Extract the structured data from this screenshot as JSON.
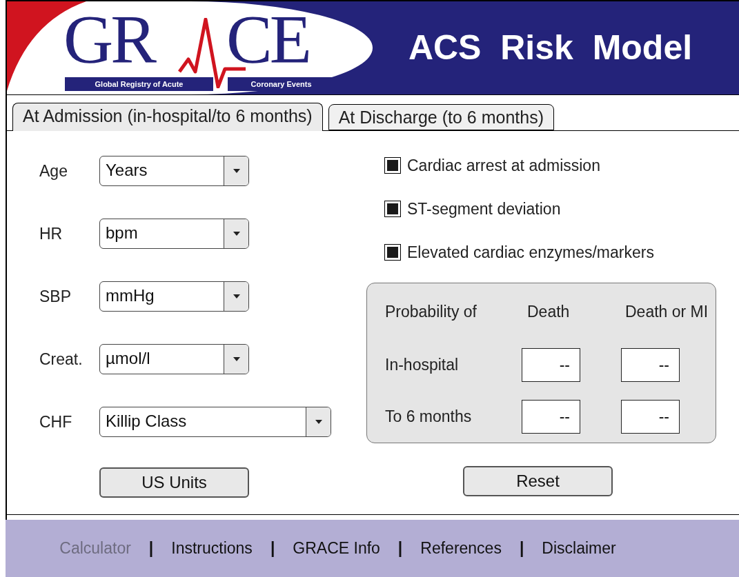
{
  "header": {
    "logo": {
      "letters_left": "GR",
      "letters_right": "CE",
      "tagline_left": "Global Registry of Acute",
      "tagline_right": "Coronary Events"
    },
    "title": "ACS  Risk  Model"
  },
  "tabs": [
    {
      "label": "At Admission (in-hospital/to 6 months)",
      "selected": true
    },
    {
      "label": "At Discharge (to 6 months)",
      "selected": false
    }
  ],
  "inputs": [
    {
      "label": "Age",
      "value": "Years",
      "wide": false
    },
    {
      "label": "HR",
      "value": "bpm",
      "wide": false
    },
    {
      "label": "SBP",
      "value": "mmHg",
      "wide": false
    },
    {
      "label": "Creat.",
      "value": "µmol/l",
      "wide": false
    },
    {
      "label": "CHF",
      "value": "Killip Class",
      "wide": true
    }
  ],
  "checkboxes": [
    {
      "label": "Cardiac arrest at admission",
      "checked": true
    },
    {
      "label": "ST-segment deviation",
      "checked": true
    },
    {
      "label": "Elevated cardiac enzymes/markers",
      "checked": true
    }
  ],
  "results": {
    "columns": [
      "Probability of",
      "Death",
      "Death or MI"
    ],
    "rows": [
      {
        "label": "In-hospital",
        "values": [
          "--",
          "--"
        ]
      },
      {
        "label": "To 6 months",
        "values": [
          "--",
          "--"
        ]
      }
    ]
  },
  "buttons": [
    "US Units",
    "Reset"
  ],
  "footer": [
    {
      "kind": "link",
      "label": "Calculator",
      "selected": true
    },
    {
      "kind": "separator",
      "label": "|"
    },
    {
      "kind": "link",
      "label": "Instructions",
      "selected": false
    },
    {
      "kind": "separator",
      "label": "|"
    },
    {
      "kind": "link",
      "label": "GRACE Info",
      "selected": false
    },
    {
      "kind": "separator",
      "label": "|"
    },
    {
      "kind": "link",
      "label": "References",
      "selected": false
    },
    {
      "kind": "separator",
      "label": "|"
    },
    {
      "kind": "link",
      "label": "Disclaimer",
      "selected": false
    }
  ]
}
